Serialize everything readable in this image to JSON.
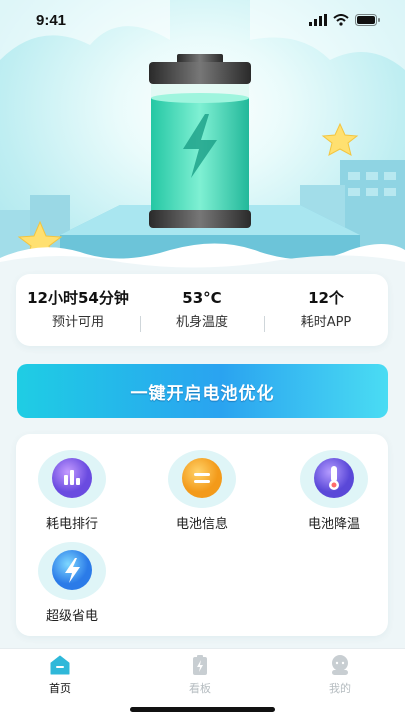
{
  "status_bar": {
    "time": "9:41"
  },
  "stats": [
    {
      "value": "12小时54分钟",
      "label": "预计可用"
    },
    {
      "value": "53°C",
      "label": "机身温度"
    },
    {
      "value": "12个",
      "label": "耗时APP"
    }
  ],
  "optimize_button": {
    "label": "一键开启电池优化"
  },
  "tools": [
    {
      "label": "耗电排行",
      "icon": "bar-chart-icon"
    },
    {
      "label": "电池信息",
      "icon": "info-list-icon"
    },
    {
      "label": "电池降温",
      "icon": "thermometer-icon"
    },
    {
      "label": "超级省电",
      "icon": "lightning-icon"
    }
  ],
  "tabs": [
    {
      "label": "首页",
      "active": true
    },
    {
      "label": "看板",
      "active": false
    },
    {
      "label": "我的",
      "active": false
    }
  ],
  "colors": {
    "accent": "#2fb8d9",
    "active_tab": "#111111",
    "inactive_tab": "#b5bcc0"
  }
}
